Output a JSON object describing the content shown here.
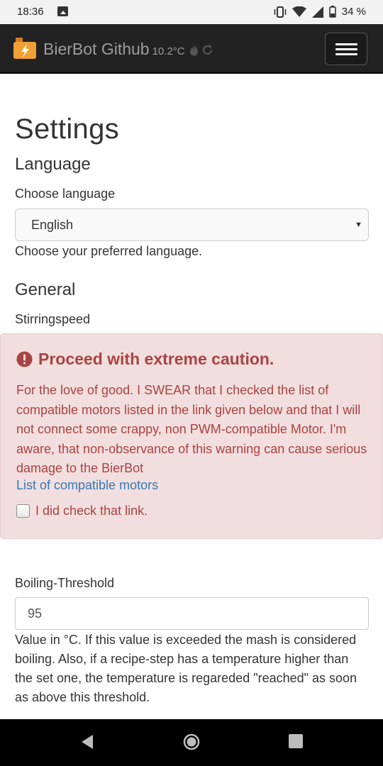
{
  "status_bar": {
    "time": "18:36",
    "battery_pct": "34 %",
    "icons": [
      "image-icon",
      "vibrate-icon",
      "wifi-icon",
      "signal-icon",
      "battery-icon"
    ]
  },
  "navbar": {
    "brand": "BierBot Github",
    "temperature": "10.2°C",
    "icons": [
      "bierbot-logo-icon",
      "flame-icon",
      "refresh-icon",
      "hamburger-menu-icon"
    ]
  },
  "page": {
    "title": "Settings",
    "language": {
      "heading": "Language",
      "label": "Choose language",
      "selected": "English",
      "help": "Choose your preferred language."
    },
    "general": {
      "heading": "General",
      "stirring_label": "Stirringspeed"
    },
    "warning": {
      "title": "Proceed with extreme caution.",
      "body": "For the love of good. I SWEAR that I checked the list of compatible motors listed in the link given below and that I will not connect some crappy, non PWM-compatible Motor. I'm aware, that non-observance of this warning can cause serious damage to the BierBot",
      "link": "List of compatible motors",
      "checkbox_label": "I did check that link.",
      "checked": false
    },
    "boiling": {
      "label": "Boiling-Threshold",
      "value": "95",
      "help": "Value in °C. If this value is exceeded the mash is considered boiling. Also, if a recipe-step has a temperature higher than the set one, the temperature is regareded \"reached\" as soon as above this threshold."
    }
  },
  "colors": {
    "navbar_bg": "#222222",
    "alert_bg": "#f2dede",
    "alert_text": "#a94442",
    "link": "#337ab7"
  }
}
